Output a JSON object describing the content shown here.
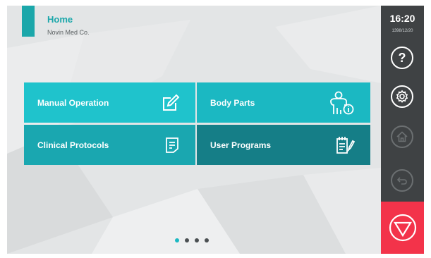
{
  "header": {
    "title": "Home",
    "subtitle": "Novin Med Co."
  },
  "tiles": [
    {
      "label": "Manual Operation",
      "icon": "edit-icon"
    },
    {
      "label": "Body Parts",
      "icon": "body-info-icon"
    },
    {
      "label": "Clinical Protocols",
      "icon": "document-icon"
    },
    {
      "label": "User Programs",
      "icon": "notepad-pencil-icon"
    }
  ],
  "pager": {
    "total": 4,
    "active": 1
  },
  "sidebar": {
    "time": "16:20",
    "date": "1398/12/20",
    "buttons": [
      {
        "icon": "help-icon",
        "glyph": "?",
        "enabled": true
      },
      {
        "icon": "gear-icon",
        "enabled": true
      },
      {
        "icon": "home-icon",
        "enabled": false
      },
      {
        "icon": "back-icon",
        "enabled": false
      },
      {
        "icon": "stop-icon",
        "enabled": true
      }
    ]
  },
  "colors": {
    "accent": "#1ba7aa",
    "tile_light": "#1fc3cc",
    "tile_dark": "#157e87",
    "sidebar": "#3f4244",
    "stop": "#f3334a"
  }
}
